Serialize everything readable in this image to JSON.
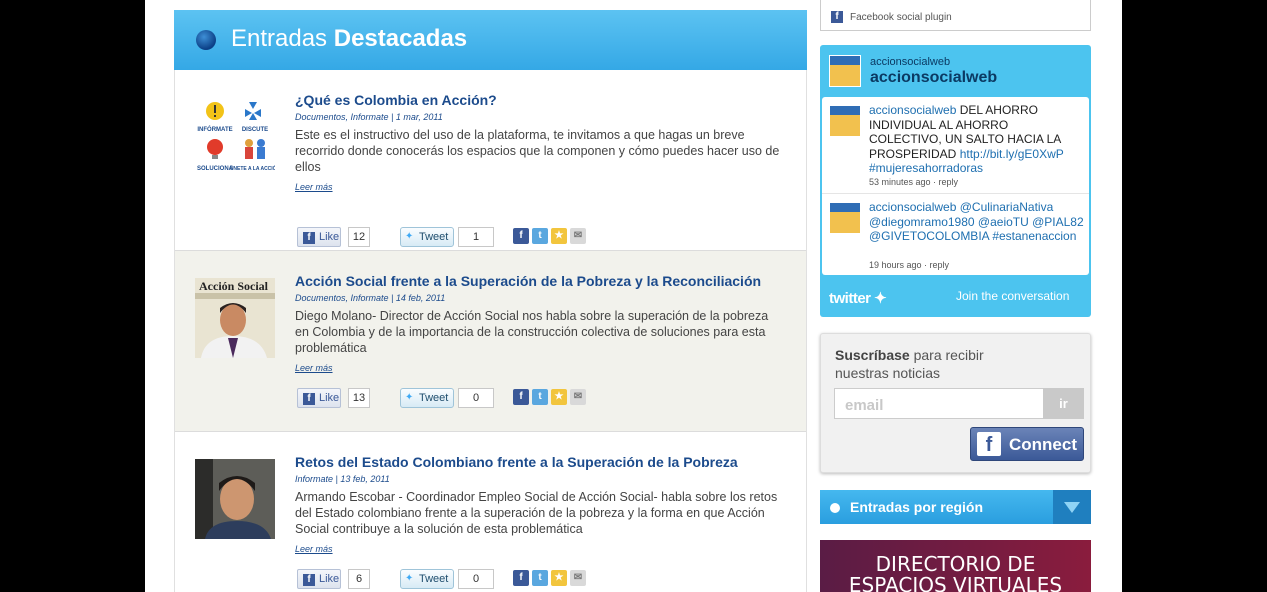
{
  "featured": {
    "title_light": "Entradas",
    "title_bold": "Destacadas"
  },
  "posts": [
    {
      "title": "¿Qué es Colombia en Acción?",
      "meta": "Documentos, Informate | 1 mar, 2011",
      "excerpt": "Este es el instructivo del uso de la plataforma, te invitamos a que hagas un breve recorrido donde conocerás los espacios que la componen y cómo puedes hacer uso de ellos",
      "more": "Leer más",
      "like_label": "Like",
      "like_count": "12",
      "tweet_label": "Tweet",
      "tweet_count": "1",
      "thumb_labels": [
        "INFÓRMATE",
        "DISCUTE",
        "SOLUCIONA",
        "ÚNETE A LA ACCIÓN"
      ]
    },
    {
      "title": "Acción Social frente a la Superación de la Pobreza y la Reconciliación",
      "meta": "Documentos, Informate | 14 feb, 2011",
      "excerpt": "Diego Molano- Director de Acción Social nos habla sobre la superación de la pobreza en Colombia y de la importancia de la construcción colectiva de soluciones para esta problemática",
      "more": "Leer más",
      "like_label": "Like",
      "like_count": "13",
      "tweet_label": "Tweet",
      "tweet_count": "0",
      "thumb_caption": "Acción Social"
    },
    {
      "title": "Retos del Estado Colombiano frente a la Superación de la Pobreza",
      "meta": "Informate | 13 feb, 2011",
      "excerpt": "Armando Escobar - Coordinador Empleo Social de Acción Social- habla sobre los retos del Estado colombiano frente a la superación de la pobreza y la forma en que Acción Social contribuye a la solución de esta problemática",
      "more": "Leer más",
      "like_label": "Like",
      "like_count": "6",
      "tweet_label": "Tweet",
      "tweet_count": "0"
    }
  ],
  "sidebar": {
    "fb_plugin": "Facebook social plugin",
    "twitter": {
      "handle_small": "accionsocialweb",
      "handle_big": "accionsocialweb",
      "tweets": [
        {
          "user": "accionsocialweb",
          "text": " DEL AHORRO INDIVIDUAL AL AHORRO COLECTIVO, UN SALTO HACIA LA PROSPERIDAD ",
          "link": "http://bit.ly/gE0XwP",
          "tag": "#mujeresahorradoras",
          "time": "53 minutes ago · reply"
        },
        {
          "user": "accionsocialweb",
          "text": " @CulinariaNativa @diegomramo1980 @aeioTU @PIAL82 @GIVETOCOLOMBIA ",
          "link": "",
          "tag": "#estanenaccion",
          "time": "19 hours ago · reply"
        }
      ],
      "logo": "twitter",
      "join": "Join the conversation"
    },
    "subscribe": {
      "title_bold": "Suscríbase",
      "title_rest": " para recibir nuestras noticias",
      "placeholder": "email",
      "go": "ir",
      "connect": "Connect"
    },
    "region": {
      "label": "Entradas por región"
    },
    "banner": {
      "line1": "DIRECTORIO DE",
      "line2": "ESPACIOS VIRTUALES"
    }
  }
}
